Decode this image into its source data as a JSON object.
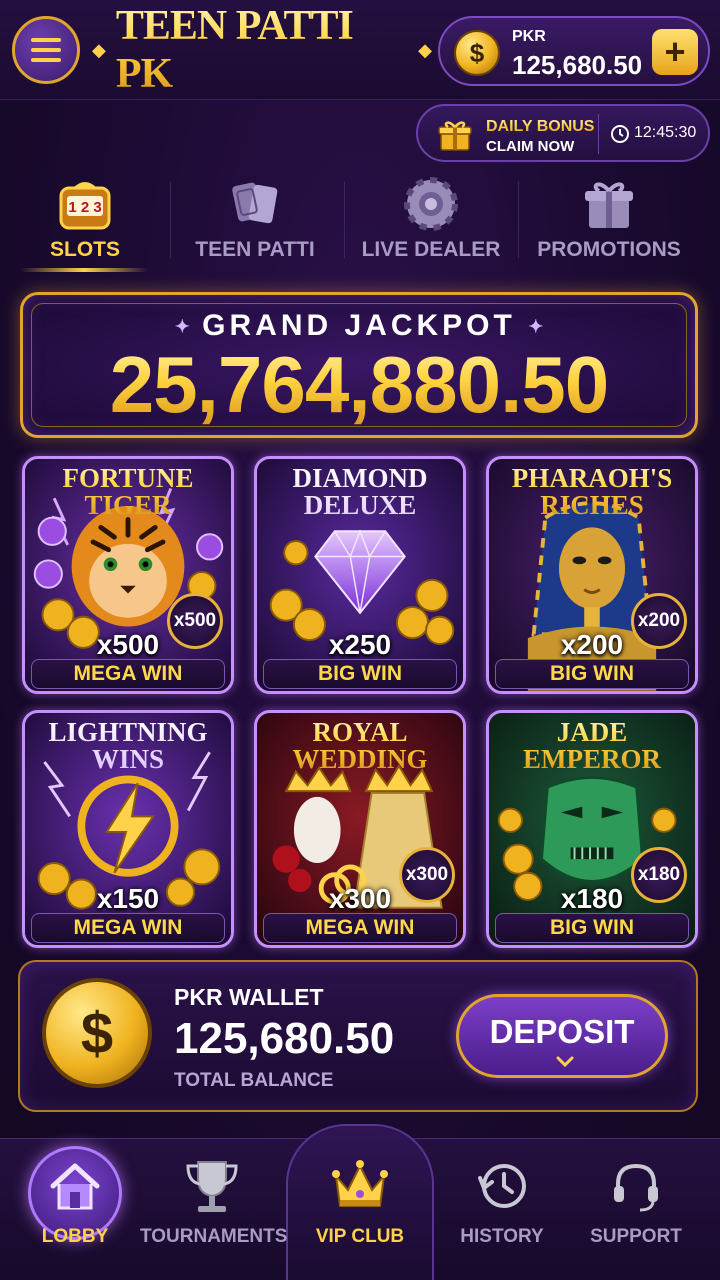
{
  "app": {
    "title": "TEEN PATTI PK",
    "balance": {
      "currency": "PKR",
      "amount": "125,680.50",
      "add_label": "+"
    }
  },
  "bonus": {
    "line1": "DAILY BONUS",
    "line2": "CLAIM NOW",
    "timer": "12:45:30"
  },
  "tabs": [
    {
      "label": "SLOTS",
      "icon": "slot-machine-icon",
      "active": true
    },
    {
      "label": "TEEN PATTI",
      "icon": "cards-icon",
      "active": false
    },
    {
      "label": "LIVE DEALER",
      "icon": "poker-chip-icon",
      "active": false
    },
    {
      "label": "PROMOTIONS",
      "icon": "gift-icon",
      "active": false
    }
  ],
  "jackpot": {
    "label": "GRAND JACKPOT",
    "amount": "25,764,880.50"
  },
  "games": [
    {
      "name": "FORTUNE\nTIGER",
      "multiplier": "x500",
      "badge": "x500",
      "win_label": "MEGA WIN"
    },
    {
      "name": "DIAMOND\nDELUXE",
      "multiplier": "x250",
      "badge": "",
      "win_label": "BIG WIN"
    },
    {
      "name": "PHARAOH'S\nRICHES",
      "multiplier": "x200",
      "badge": "x200",
      "win_label": "BIG WIN"
    },
    {
      "name": "LIGHTNING\nWINS",
      "multiplier": "x150",
      "badge": "",
      "win_label": "MEGA WIN"
    },
    {
      "name": "ROYAL\nWEDDING",
      "multiplier": "x300",
      "badge": "x300",
      "win_label": "MEGA WIN"
    },
    {
      "name": "JADE\nEMPEROR",
      "multiplier": "x180",
      "badge": "x180",
      "win_label": "BIG WIN"
    }
  ],
  "wallet": {
    "label": "PKR WALLET",
    "amount": "125,680.50",
    "sub": "TOTAL BALANCE",
    "deposit_label": "DEPOSIT"
  },
  "nav": [
    {
      "label": "LOBBY",
      "icon": "home-icon",
      "active": true
    },
    {
      "label": "TOURNAMENTS",
      "icon": "trophy-icon",
      "active": false
    },
    {
      "label": "VIP CLUB",
      "icon": "crown-icon",
      "active": false
    },
    {
      "label": "HISTORY",
      "icon": "history-icon",
      "active": false
    },
    {
      "label": "SUPPORT",
      "icon": "headset-icon",
      "active": false
    }
  ],
  "colors": {
    "gold": "#ffd24a",
    "purple": "#4b1d8a",
    "bg": "#1a0a30",
    "accent_border": "#c58fff"
  }
}
